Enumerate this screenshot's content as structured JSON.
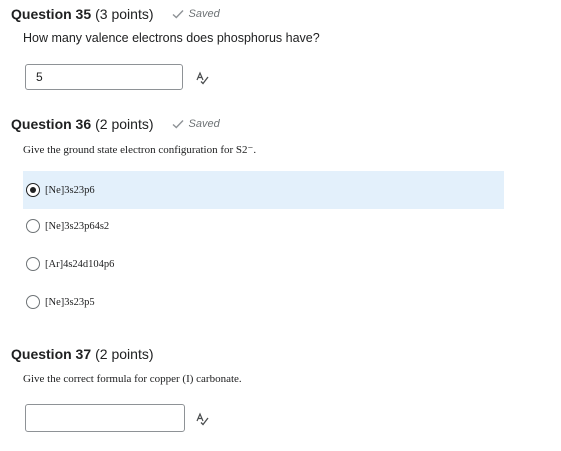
{
  "questions": [
    {
      "title": "Question 35",
      "points": "(3 points)",
      "status": "Saved",
      "prompt": "How many valence electrons does phosphorus have?",
      "answer_value": "5"
    },
    {
      "title": "Question 36",
      "points": "(2 points)",
      "status": "Saved",
      "prompt": "Give the ground state electron configuration for S2⁻.",
      "options": [
        {
          "label": "[Ne]3s23p6",
          "selected": true
        },
        {
          "label": "[Ne]3s23p64s2",
          "selected": false
        },
        {
          "label": "[Ar]4s24d104p6",
          "selected": false
        },
        {
          "label": "[Ne]3s23p5",
          "selected": false
        }
      ]
    },
    {
      "title": "Question 37",
      "points": "(2 points)",
      "prompt": "Give the correct formula for copper (I) carbonate.",
      "answer_value": ""
    }
  ],
  "icons": {
    "saved": "checkmark-icon",
    "spell_check": "spell-check-icon"
  },
  "colors": {
    "selected_option_bg": "#e3f0fb",
    "muted_text": "#6e7376"
  }
}
